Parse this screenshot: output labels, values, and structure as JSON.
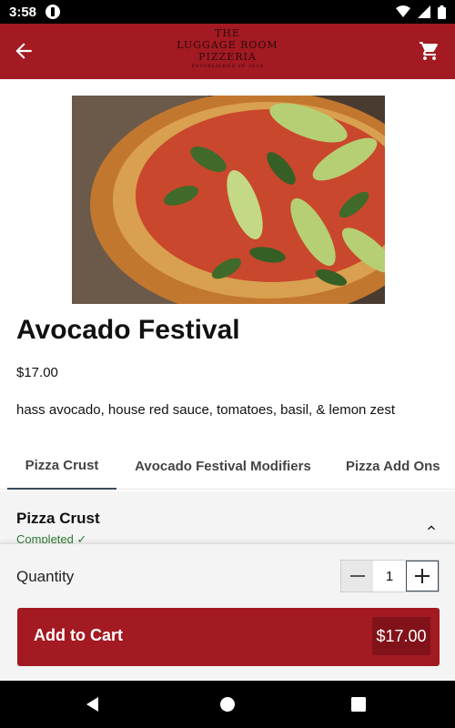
{
  "status_bar": {
    "time": "3:58"
  },
  "header": {
    "logo_lines": [
      "THE",
      "LUGGAGE ROOM",
      "PIZZERIA"
    ],
    "logo_tagline": "ESTABLISHED IN 2010",
    "icons": {
      "back": "arrow-left-icon",
      "cart": "shopping-cart-icon"
    }
  },
  "product": {
    "title": "Avocado Festival",
    "price": "$17.00",
    "description": "hass avocado, house red sauce, tomatoes, basil, & lemon zest"
  },
  "tabs": [
    {
      "label": "Pizza Crust",
      "active": true
    },
    {
      "label": "Avocado Festival Modifiers",
      "active": false
    },
    {
      "label": "Pizza Add Ons",
      "active": false
    }
  ],
  "section": {
    "title": "Pizza Crust",
    "status": "Completed ✓"
  },
  "quantity": {
    "label": "Quantity",
    "value": "1"
  },
  "add_to_cart": {
    "label": "Add to Cart",
    "price": "$17.00"
  },
  "colors": {
    "brand_red": "#a31a22",
    "dark_red": "#821219",
    "success_green": "#2e7d32"
  }
}
